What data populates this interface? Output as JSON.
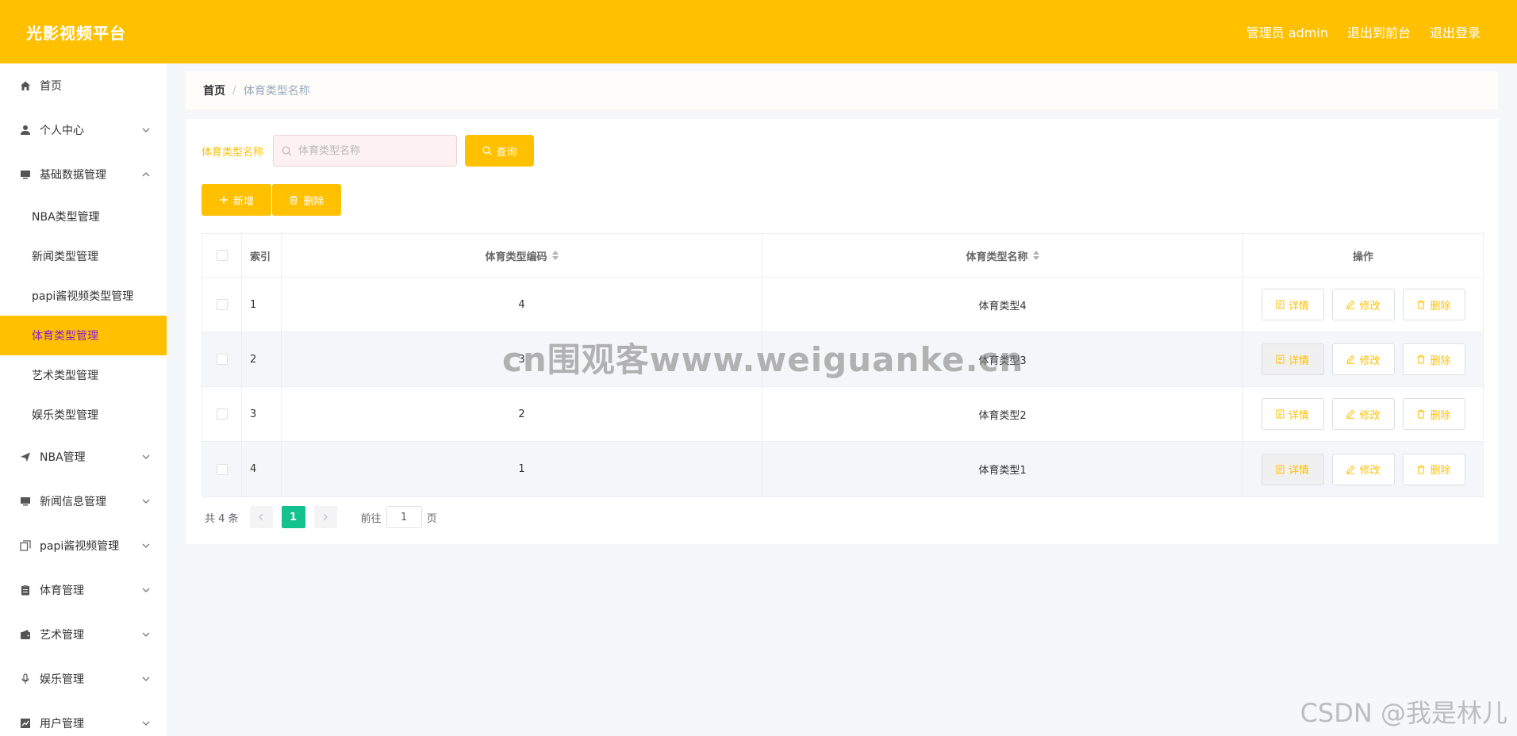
{
  "header": {
    "brand": "光影视频平台",
    "admin_label": "管理员 admin",
    "to_front_label": "退出到前台",
    "logout_label": "退出登录"
  },
  "sidebar": {
    "items": [
      {
        "label": "首页",
        "icon": "home-icon"
      },
      {
        "label": "个人中心",
        "icon": "user-icon"
      },
      {
        "label": "基础数据管理",
        "icon": "monitor-icon"
      },
      {
        "label": "NBA管理",
        "icon": "send-icon"
      },
      {
        "label": "新闻信息管理",
        "icon": "monitor-icon"
      },
      {
        "label": "papi酱视频管理",
        "icon": "copy-icon"
      },
      {
        "label": "体育管理",
        "icon": "clipboard-icon"
      },
      {
        "label": "艺术管理",
        "icon": "wallet-icon"
      },
      {
        "label": "娱乐管理",
        "icon": "mic-icon"
      },
      {
        "label": "用户管理",
        "icon": "chart-icon"
      }
    ],
    "sub_items": [
      {
        "label": "NBA类型管理"
      },
      {
        "label": "新闻类型管理"
      },
      {
        "label": "papi酱视频类型管理"
      },
      {
        "label": "体育类型管理"
      },
      {
        "label": "艺术类型管理"
      },
      {
        "label": "娱乐类型管理"
      }
    ]
  },
  "breadcrumb": {
    "home": "首页",
    "separator": "/",
    "current": "体育类型名称"
  },
  "search": {
    "label": "体育类型名称",
    "placeholder": "体育类型名称",
    "query_label": "查询"
  },
  "actions": {
    "add_label": "新增",
    "delete_label": "删除"
  },
  "table": {
    "headers": {
      "index": "索引",
      "code": "体育类型编码",
      "name": "体育类型名称",
      "ops": "操作"
    },
    "rows": [
      {
        "index": "1",
        "code": "4",
        "name": "体育类型4"
      },
      {
        "index": "2",
        "code": "3",
        "name": "体育类型3"
      },
      {
        "index": "3",
        "code": "2",
        "name": "体育类型2"
      },
      {
        "index": "4",
        "code": "1",
        "name": "体育类型1"
      }
    ],
    "op_labels": {
      "detail": "详情",
      "edit": "修改",
      "delete": "删除"
    }
  },
  "pagination": {
    "total_text": "共 4 条",
    "current_page": "1",
    "goto_label": "前往",
    "goto_value": "1",
    "page_suffix": "页"
  },
  "watermarks": {
    "center": "cn围观客www.weiguanke.cn",
    "corner": "CSDN @我是林儿"
  },
  "colors": {
    "accent": "#ffc000",
    "active_text": "#8a1bd6",
    "page_active": "#13c28d"
  }
}
